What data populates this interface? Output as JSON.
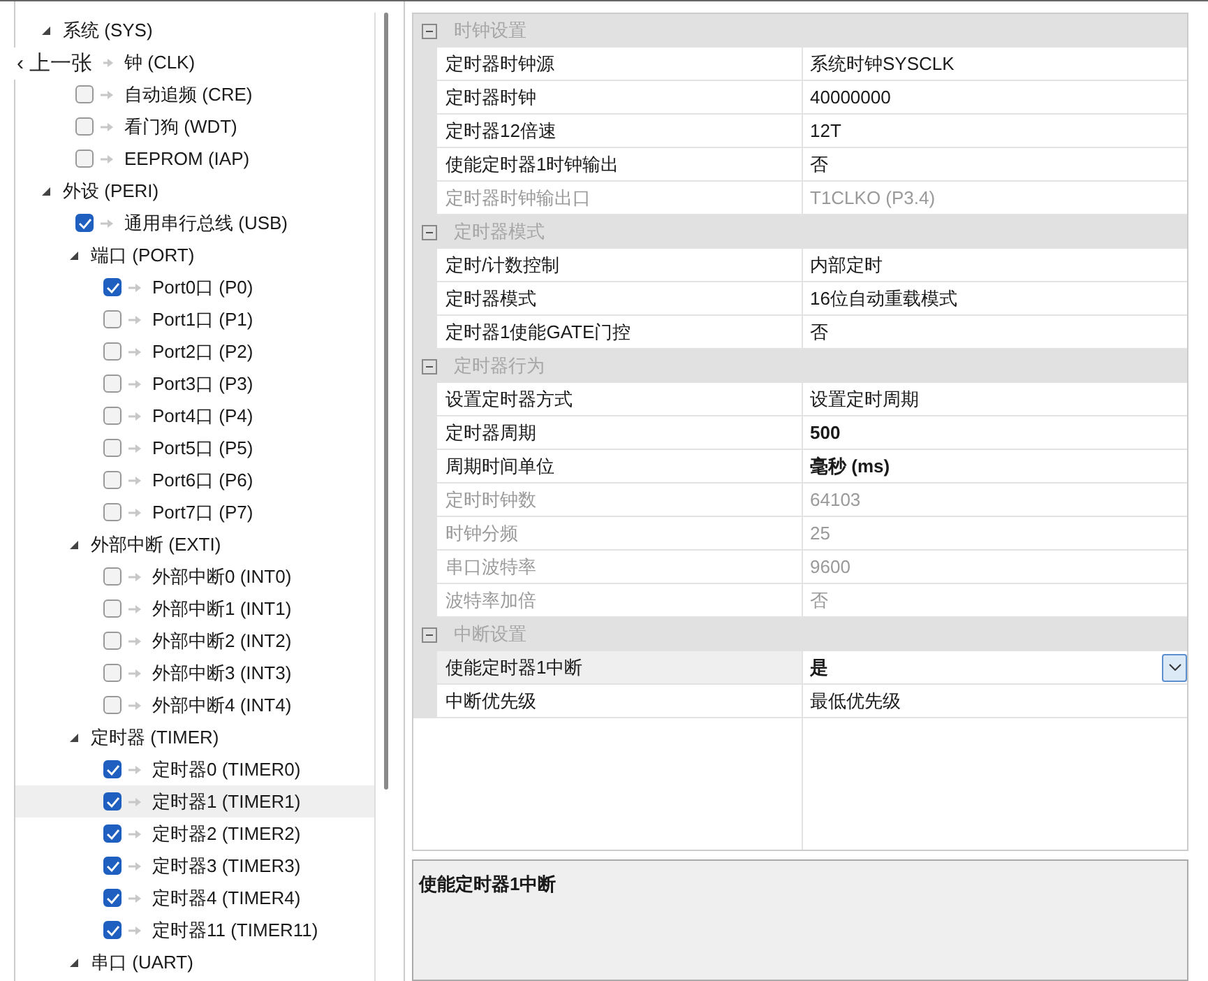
{
  "prev_button": {
    "icon": "‹",
    "label": "上一张"
  },
  "tree": [
    {
      "label": "系统 (SYS)",
      "kind": "group",
      "expanded": true,
      "children": [
        {
          "label": "钟 (CLK)",
          "kind": "leaf_covered",
          "selected": false
        },
        {
          "label": "自动追频 (CRE)",
          "kind": "leaf",
          "checked": false,
          "selected": false
        },
        {
          "label": "看门狗 (WDT)",
          "kind": "leaf",
          "checked": false,
          "selected": false
        },
        {
          "label": "EEPROM (IAP)",
          "kind": "leaf",
          "checked": false,
          "selected": false
        }
      ]
    },
    {
      "label": "外设 (PERI)",
      "kind": "group",
      "expanded": true,
      "children": [
        {
          "label": "通用串行总线 (USB)",
          "kind": "leaf",
          "checked": true,
          "selected": false
        },
        {
          "label": "端口 (PORT)",
          "kind": "group",
          "expanded": true,
          "children": [
            {
              "label": "Port0口 (P0)",
              "kind": "leaf",
              "checked": true,
              "selected": false
            },
            {
              "label": "Port1口 (P1)",
              "kind": "leaf",
              "checked": false,
              "selected": false
            },
            {
              "label": "Port2口 (P2)",
              "kind": "leaf",
              "checked": false,
              "selected": false
            },
            {
              "label": "Port3口 (P3)",
              "kind": "leaf",
              "checked": false,
              "selected": false
            },
            {
              "label": "Port4口 (P4)",
              "kind": "leaf",
              "checked": false,
              "selected": false
            },
            {
              "label": "Port5口 (P5)",
              "kind": "leaf",
              "checked": false,
              "selected": false
            },
            {
              "label": "Port6口 (P6)",
              "kind": "leaf",
              "checked": false,
              "selected": false
            },
            {
              "label": "Port7口 (P7)",
              "kind": "leaf",
              "checked": false,
              "selected": false
            }
          ]
        },
        {
          "label": "外部中断 (EXTI)",
          "kind": "group",
          "expanded": true,
          "children": [
            {
              "label": "外部中断0 (INT0)",
              "kind": "leaf",
              "checked": false,
              "selected": false
            },
            {
              "label": "外部中断1 (INT1)",
              "kind": "leaf",
              "checked": false,
              "selected": false
            },
            {
              "label": "外部中断2 (INT2)",
              "kind": "leaf",
              "checked": false,
              "selected": false
            },
            {
              "label": "外部中断3 (INT3)",
              "kind": "leaf",
              "checked": false,
              "selected": false
            },
            {
              "label": "外部中断4 (INT4)",
              "kind": "leaf",
              "checked": false,
              "selected": false
            }
          ]
        },
        {
          "label": "定时器 (TIMER)",
          "kind": "group",
          "expanded": true,
          "children": [
            {
              "label": "定时器0 (TIMER0)",
              "kind": "leaf",
              "checked": true,
              "selected": false
            },
            {
              "label": "定时器1 (TIMER1)",
              "kind": "leaf",
              "checked": true,
              "selected": true
            },
            {
              "label": "定时器2 (TIMER2)",
              "kind": "leaf",
              "checked": true,
              "selected": false
            },
            {
              "label": "定时器3 (TIMER3)",
              "kind": "leaf",
              "checked": true,
              "selected": false
            },
            {
              "label": "定时器4 (TIMER4)",
              "kind": "leaf",
              "checked": true,
              "selected": false
            },
            {
              "label": "定时器11 (TIMER11)",
              "kind": "leaf",
              "checked": true,
              "selected": false
            }
          ]
        },
        {
          "label": "串口 (UART)",
          "kind": "group",
          "expanded": true
        }
      ]
    }
  ],
  "properties": [
    {
      "category": "时钟设置",
      "expanded": true,
      "rows": [
        {
          "name": "定时器时钟源",
          "value": "系统时钟SYSCLK",
          "disabled": false,
          "bold": false,
          "selected": false
        },
        {
          "name": "定时器时钟",
          "value": "40000000",
          "disabled": false,
          "bold": false,
          "selected": false
        },
        {
          "name": "定时器12倍速",
          "value": "12T",
          "disabled": false,
          "bold": false,
          "selected": false
        },
        {
          "name": "使能定时器1时钟输出",
          "value": "否",
          "disabled": false,
          "bold": false,
          "selected": false
        },
        {
          "name": "定时器时钟输出口",
          "value": "T1CLKO (P3.4)",
          "disabled": true,
          "bold": false,
          "selected": false
        }
      ]
    },
    {
      "category": "定时器模式",
      "expanded": true,
      "rows": [
        {
          "name": "定时/计数控制",
          "value": "内部定时",
          "disabled": false,
          "bold": false,
          "selected": false
        },
        {
          "name": "定时器模式",
          "value": "16位自动重载模式",
          "disabled": false,
          "bold": false,
          "selected": false
        },
        {
          "name": "定时器1使能GATE门控",
          "value": "否",
          "disabled": false,
          "bold": false,
          "selected": false
        }
      ]
    },
    {
      "category": "定时器行为",
      "expanded": true,
      "rows": [
        {
          "name": "设置定时器方式",
          "value": "设置定时周期",
          "disabled": false,
          "bold": false,
          "selected": false
        },
        {
          "name": "定时器周期",
          "value": "500",
          "disabled": false,
          "bold": true,
          "selected": false
        },
        {
          "name": "周期时间单位",
          "value": "毫秒 (ms)",
          "disabled": false,
          "bold": true,
          "selected": false
        },
        {
          "name": "定时时钟数",
          "value": "64103",
          "disabled": true,
          "bold": false,
          "selected": false
        },
        {
          "name": "时钟分频",
          "value": "25",
          "disabled": true,
          "bold": false,
          "selected": false
        },
        {
          "name": "串口波特率",
          "value": "9600",
          "disabled": true,
          "bold": false,
          "selected": false
        },
        {
          "name": "波特率加倍",
          "value": "否",
          "disabled": true,
          "bold": false,
          "selected": false
        }
      ]
    },
    {
      "category": "中断设置",
      "expanded": true,
      "rows": [
        {
          "name": "使能定时器1中断",
          "value": "是",
          "disabled": false,
          "bold": true,
          "selected": true
        },
        {
          "name": "中断优先级",
          "value": "最低优先级",
          "disabled": false,
          "bold": false,
          "selected": false
        }
      ]
    }
  ],
  "description": {
    "title": "使能定时器1中断"
  }
}
